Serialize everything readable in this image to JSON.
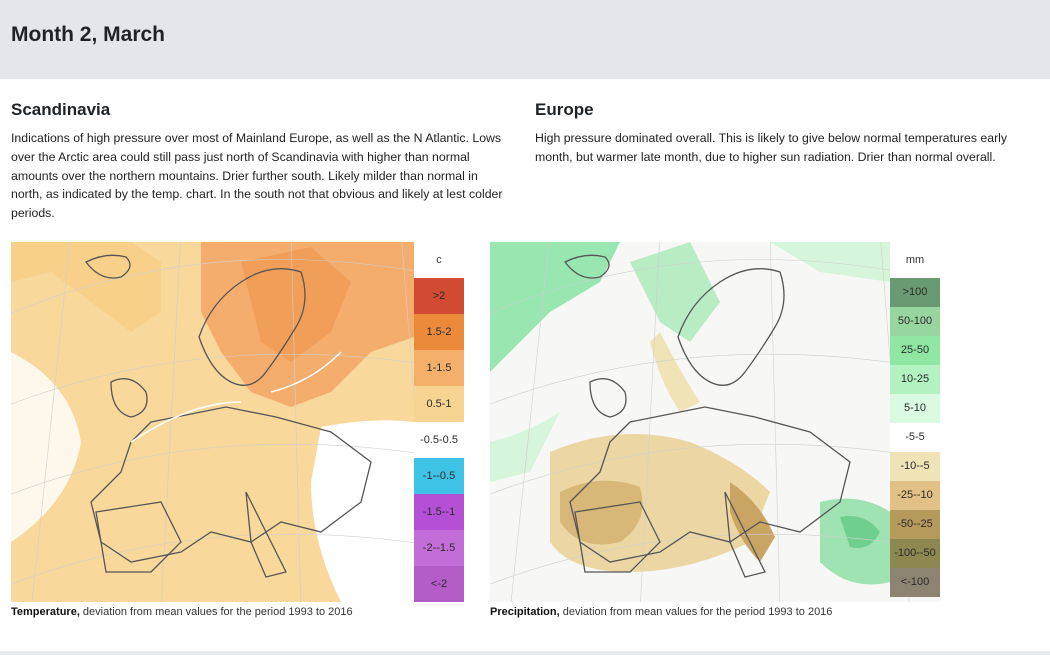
{
  "header": {
    "title": "Month 2, March"
  },
  "scandinavia": {
    "heading": "Scandinavia",
    "text": "Indications of high pressure over most of Mainland Europe, as well as the N Atlantic. Lows over the Arctic area could still pass just north of Scandinavia with higher than normal amounts over the northern mountains. Drier further south. Likely milder than normal in north, as indicated by the temp. chart. In the south not that obvious and likely at lest colder periods."
  },
  "europe": {
    "heading": "Europe",
    "text": "High pressure dominated overall. This is likely to give below normal temperatures early month, but warmer late month, due to higher sun radiation. Drier than normal overall."
  },
  "temperature_map": {
    "legend_unit": "c",
    "legend": [
      {
        "label": ">2",
        "color": "#d34a33"
      },
      {
        "label": "1.5-2",
        "color": "#ec8a3c"
      },
      {
        "label": "1-1.5",
        "color": "#f4b06a"
      },
      {
        "label": "0.5-1",
        "color": "#f8d493"
      },
      {
        "label": "-0.5-0.5",
        "color": "#ffffff"
      },
      {
        "label": "-1--0.5",
        "color": "#3ec3e6"
      },
      {
        "label": "-1.5--1",
        "color": "#b550d6"
      },
      {
        "label": "-2--1.5",
        "color": "#c36dd8"
      },
      {
        "label": "<-2",
        "color": "#b45dc6"
      }
    ],
    "caption_bold": "Temperature,",
    "caption_rest": " deviation from mean values for the period 1993 to 2016"
  },
  "precipitation_map": {
    "legend_unit": "mm",
    "legend": [
      {
        "label": ">100",
        "color": "#6a9a71"
      },
      {
        "label": "50-100",
        "color": "#97d69f"
      },
      {
        "label": "25-50",
        "color": "#8fe7a3"
      },
      {
        "label": "10-25",
        "color": "#b3f2c1"
      },
      {
        "label": "5-10",
        "color": "#dafbe2"
      },
      {
        "label": "-5-5",
        "color": "#ffffff"
      },
      {
        "label": "-10--5",
        "color": "#f0e3b6"
      },
      {
        "label": "-25--10",
        "color": "#e2c186"
      },
      {
        "label": "-50--25",
        "color": "#b59a5c"
      },
      {
        "label": "-100--50",
        "color": "#8d8750"
      },
      {
        "label": "<-100",
        "color": "#8c8471"
      }
    ],
    "caption_bold": "Precipitation,",
    "caption_rest": " deviation from mean values for the period 1993 to 2016"
  },
  "colors": {
    "header_bg": "#e3e7ea",
    "temp_base": "#f9d89c",
    "temp_warm": "#f5ad6d",
    "precip_dry": "#ecd7a4",
    "precip_wet": "#98e7b0"
  }
}
